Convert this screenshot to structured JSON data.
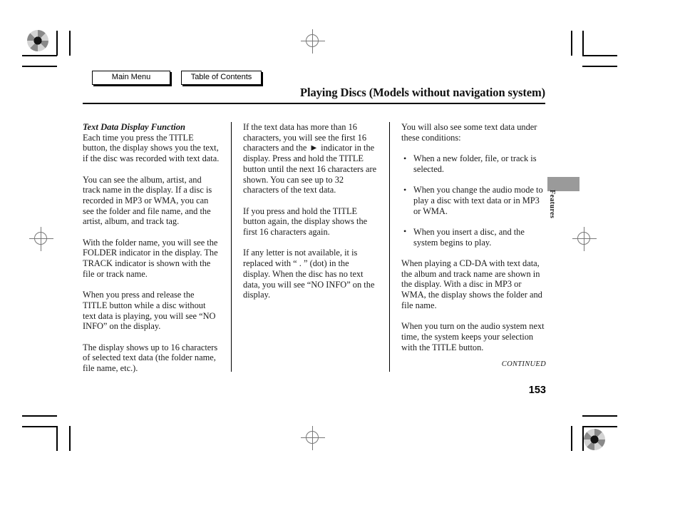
{
  "nav": {
    "buttons": [
      {
        "label": "Main Menu"
      },
      {
        "label": "Table of Contents"
      }
    ]
  },
  "header": {
    "title": "Playing Discs (Models without navigation system)"
  },
  "columns": [
    {
      "heading": "Text Data Display Function",
      "paragraphs": [
        "Each time you press the TITLE button, the display shows you the text, if the disc was recorded with text data.",
        "You can see the album, artist, and track name in the display. If a disc is recorded in MP3 or WMA, you can see the folder and file name, and the artist, album, and track tag.",
        "With the folder name, you will see the FOLDER indicator in the display. The TRACK indicator is shown with the file or track name.",
        "When you press and release the TITLE button while a disc without text data is playing, you will see “NO INFO” on the display.",
        "The display shows up to 16 characters of selected text data (the folder name, file name, etc.)."
      ]
    },
    {
      "paragraphs_a": "If the text data has more than 16 characters, you will see the first 16 characters and the",
      "indicator_glyph": "▶",
      "paragraphs_b": "indicator in the display. Press and hold the TITLE button until the next 16 characters are shown. You can see up to 32 characters of the text data.",
      "paragraphs": [
        "If you press and hold the TITLE button again, the display shows the first 16 characters again.",
        "If any letter is not available, it is replaced with “ . ” (dot) in the display. When the disc has no text data, you will see “NO INFO” on the display."
      ]
    },
    {
      "intro": "You will also see some text data under these conditions:",
      "bullets": [
        "When a new folder, file, or track is selected.",
        "When you change the audio mode to play a disc with text data or in MP3 or WMA.",
        "When you insert a disc, and the system begins to play."
      ],
      "paragraphs": [
        "When playing a CD-DA with text data, the album and track name are shown in the display. With a disc in MP3 or WMA, the display shows the folder and file name.",
        "When you turn on the audio system next time, the system keeps your selection with the TITLE button."
      ]
    }
  ],
  "footer": {
    "continued": "CONTINUED",
    "page_number": "153"
  },
  "side_tab": {
    "label": "Features",
    "color": "#9a9a9a"
  }
}
